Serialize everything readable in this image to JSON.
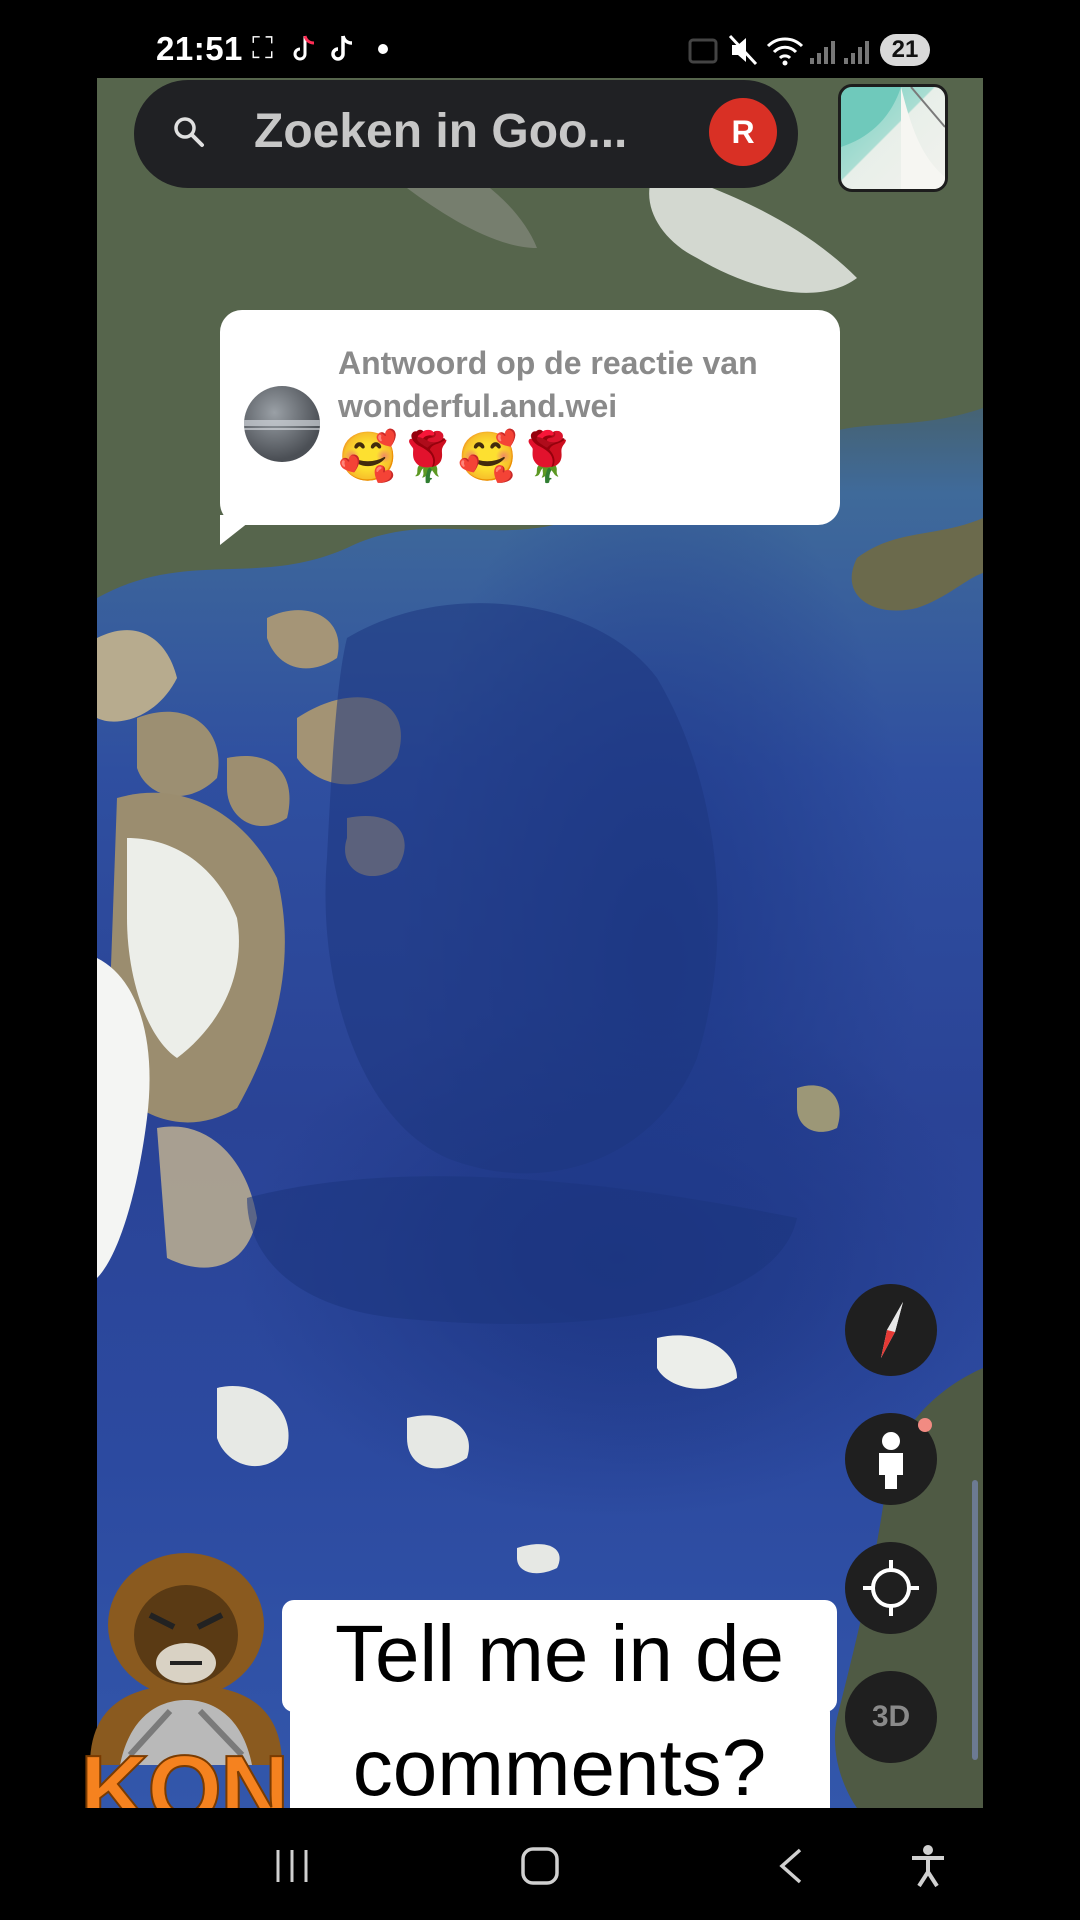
{
  "status_bar": {
    "time": "21:51",
    "battery": "21",
    "left_icons": [
      "screenshot-icon",
      "tiktok-lite-icon",
      "tiktok-icon",
      "dot-icon"
    ],
    "right_icons": [
      "nfc-icon",
      "mute-icon",
      "wifi-icon",
      "signal-icon",
      "signal-icon"
    ]
  },
  "search": {
    "placeholder": "Zoeken in Goo...",
    "account_initial": "R"
  },
  "comment": {
    "title": "Antwoord op de reactie van wonderful.and.wei",
    "emoji": "🥰🌹🥰🌹"
  },
  "controls": {
    "btn_3d": "3D",
    "compass_icon": "compass-icon",
    "streetview_icon": "pegman-icon",
    "location_icon": "my-location-icon"
  },
  "caption": {
    "line1": "Tell me in de",
    "line2": "comments?"
  },
  "logo": {
    "text": "KONG"
  },
  "nav": {
    "icons": [
      "recents-icon",
      "home-icon",
      "back-icon",
      "accessibility-icon"
    ]
  },
  "colors": {
    "search_bg": "#202124",
    "account_red": "#d93025",
    "logo_orange": "#f5821f",
    "ocean": "#2a4396"
  }
}
